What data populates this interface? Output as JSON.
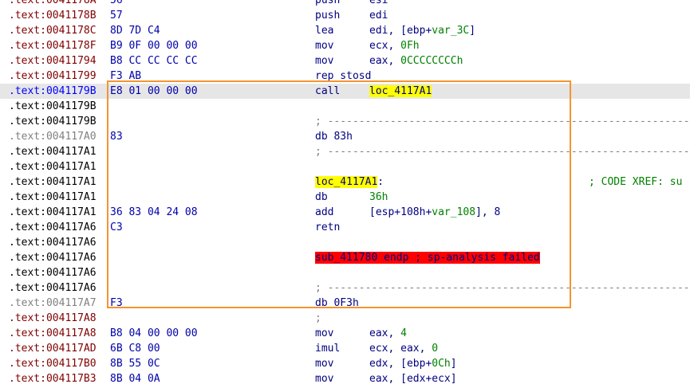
{
  "listing": {
    "lines": [
      {
        "kind": "code",
        "seg": ".text:",
        "off": "0041178A",
        "bytes": "56",
        "mnem": "push",
        "ops": [
          {
            "t": "esi",
            "s": "plain"
          }
        ]
      },
      {
        "kind": "code",
        "seg": ".text:",
        "off": "0041178B",
        "bytes": "57",
        "mnem": "push",
        "ops": [
          {
            "t": "edi",
            "s": "plain"
          }
        ]
      },
      {
        "kind": "code",
        "seg": ".text:",
        "off": "0041178C",
        "bytes": "8D 7D C4",
        "mnem": "lea",
        "ops": [
          {
            "t": "edi, [ebp+",
            "s": "plain"
          },
          {
            "t": "var_3C",
            "s": "var"
          },
          {
            "t": "]",
            "s": "plain"
          }
        ]
      },
      {
        "kind": "code",
        "seg": ".text:",
        "off": "0041178F",
        "bytes": "B9 0F 00 00 00",
        "mnem": "mov",
        "ops": [
          {
            "t": "ecx, ",
            "s": "plain"
          },
          {
            "t": "0Fh",
            "s": "num"
          }
        ]
      },
      {
        "kind": "code",
        "seg": ".text:",
        "off": "00411794",
        "bytes": "B8 CC CC CC CC",
        "mnem": "mov",
        "ops": [
          {
            "t": "eax, ",
            "s": "plain"
          },
          {
            "t": "0CCCCCCCCh",
            "s": "num"
          }
        ]
      },
      {
        "kind": "code",
        "seg": ".text:",
        "off": "00411799",
        "bytes": "F3 AB",
        "mnem": "rep stosd",
        "ops": []
      },
      {
        "kind": "sel",
        "seg": ".text:",
        "off": "0041179B",
        "bytes": "E8 01 00 00 00",
        "mnem": "call",
        "ops": [
          {
            "t": "loc_4117A1",
            "s": "hl"
          }
        ]
      },
      {
        "kind": "plain",
        "seg": ".text:",
        "off": "0041179B",
        "bytes": "",
        "mnem": "",
        "ops": []
      },
      {
        "kind": "plain",
        "seg": ".text:",
        "off": "0041179B",
        "bytes": "",
        "mnem": "",
        "ops": [],
        "rule": "; ---------------------------------------------------------------"
      },
      {
        "kind": "data",
        "seg": ".text:",
        "off": "004117A0",
        "bytes": "83",
        "mnem": "db 83h",
        "ops": []
      },
      {
        "kind": "plain",
        "seg": ".text:",
        "off": "004117A1",
        "bytes": "",
        "mnem": "",
        "ops": [],
        "rule": "; ---------------------------------------------------------------"
      },
      {
        "kind": "plain",
        "seg": ".text:",
        "off": "004117A1",
        "bytes": "",
        "mnem": "",
        "ops": []
      },
      {
        "kind": "plain",
        "seg": ".text:",
        "off": "004117A1",
        "bytes": "",
        "mnem": "",
        "ops": [],
        "label": "loc_4117A1",
        "comment": "; CODE XREF: su"
      },
      {
        "kind": "plain",
        "seg": ".text:",
        "off": "004117A1",
        "bytes": "",
        "mnem": "db",
        "ops": [
          {
            "t": "36h",
            "s": "num"
          }
        ]
      },
      {
        "kind": "plain",
        "seg": ".text:",
        "off": "004117A1",
        "bytes": "36 83 04 24 08",
        "mnem": "add",
        "ops": [
          {
            "t": "[esp+108h+",
            "s": "plain"
          },
          {
            "t": "var_108",
            "s": "var"
          },
          {
            "t": "], 8",
            "s": "plain"
          }
        ]
      },
      {
        "kind": "plain",
        "seg": ".text:",
        "off": "004117A6",
        "bytes": "C3",
        "mnem": "retn",
        "ops": []
      },
      {
        "kind": "plain",
        "seg": ".text:",
        "off": "004117A6",
        "bytes": "",
        "mnem": "",
        "ops": []
      },
      {
        "kind": "plain",
        "seg": ".text:",
        "off": "004117A6",
        "bytes": "",
        "mnem": "",
        "ops": [],
        "error": "sub_411780 endp ; sp-analysis failed"
      },
      {
        "kind": "plain",
        "seg": ".text:",
        "off": "004117A6",
        "bytes": "",
        "mnem": "",
        "ops": []
      },
      {
        "kind": "plain",
        "seg": ".text:",
        "off": "004117A6",
        "bytes": "",
        "mnem": "",
        "ops": [],
        "rule": "; ---------------------------------------------------------------"
      },
      {
        "kind": "data",
        "seg": ".text:",
        "off": "004117A7",
        "bytes": "F3",
        "mnem": "db 0F3h",
        "ops": []
      },
      {
        "kind": "code",
        "seg": ".text:",
        "off": "004117A8",
        "bytes": "",
        "mnem": "",
        "ops": [],
        "rule": ";"
      },
      {
        "kind": "code",
        "seg": ".text:",
        "off": "004117A8",
        "bytes": "B8 04 00 00 00",
        "mnem": "mov",
        "ops": [
          {
            "t": "eax, ",
            "s": "plain"
          },
          {
            "t": "4",
            "s": "num"
          }
        ]
      },
      {
        "kind": "code",
        "seg": ".text:",
        "off": "004117AD",
        "bytes": "6B C8 00",
        "mnem": "imul",
        "ops": [
          {
            "t": "ecx, eax, ",
            "s": "plain"
          },
          {
            "t": "0",
            "s": "num"
          }
        ]
      },
      {
        "kind": "code",
        "seg": ".text:",
        "off": "004117B0",
        "bytes": "8B 55 0C",
        "mnem": "mov",
        "ops": [
          {
            "t": "edx, [ebp+",
            "s": "plain"
          },
          {
            "t": "0Ch",
            "s": "num"
          },
          {
            "t": "]",
            "s": "plain"
          }
        ]
      },
      {
        "kind": "code",
        "seg": ".text:",
        "off": "004117B3",
        "bytes": "8B 04 0A",
        "mnem": "mov",
        "ops": [
          {
            "t": "eax, [edx+ecx]",
            "s": "plain"
          }
        ]
      }
    ]
  },
  "colors": {
    "highlight_box": "#f39530",
    "selected_row": "#e6e6e6",
    "label_highlight": "#ffff00",
    "error_highlight": "#ff0000"
  }
}
